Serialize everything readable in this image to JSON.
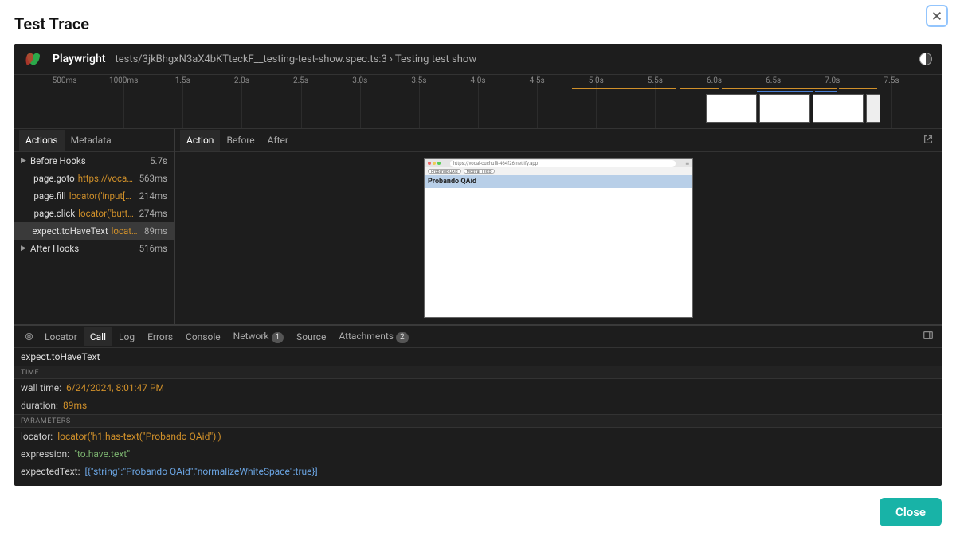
{
  "modal": {
    "title": "Test Trace",
    "close_btn": "Close"
  },
  "header": {
    "product": "Playwright",
    "spec": "tests/3jkBhgxN3aX4bKTteckF__testing-test-show.spec.ts:3 › Testing test show"
  },
  "timeline": {
    "ticks": [
      "500ms",
      "1000ms",
      "1.5s",
      "2.0s",
      "2.5s",
      "3.0s",
      "3.5s",
      "4.0s",
      "4.5s",
      "5.0s",
      "5.5s",
      "6.0s",
      "6.5s",
      "7.0s",
      "7.5s"
    ]
  },
  "left_tabs": {
    "actions": "Actions",
    "metadata": "Metadata"
  },
  "actions": {
    "before_hooks": {
      "label": "Before Hooks",
      "dur": "5.7s"
    },
    "after_hooks": {
      "label": "After Hooks",
      "dur": "516ms"
    },
    "steps": [
      {
        "name": "page.goto",
        "loc": "https://vocal-cu…",
        "dur": "563ms"
      },
      {
        "name": "page.fill",
        "loc": "locator('input[plac…",
        "dur": "214ms"
      },
      {
        "name": "page.click",
        "loc": "locator('button:…",
        "dur": "274ms"
      },
      {
        "name": "expect.toHaveText",
        "loc": "locator('…",
        "dur": "89ms"
      }
    ]
  },
  "right_tabs": {
    "action": "Action",
    "before": "Before",
    "after": "After"
  },
  "browser": {
    "url": "https://vocal-cuchufli-464f26.netlify.app",
    "btn1": "Probando QAid",
    "btn2": "Mostrar Texto",
    "h1": "Probando QAid"
  },
  "bottom_tabs": {
    "locator": "Locator",
    "call": "Call",
    "log": "Log",
    "errors": "Errors",
    "console": "Console",
    "network": "Network",
    "network_n": "1",
    "source": "Source",
    "attachments": "Attachments",
    "attachments_n": "2"
  },
  "call": {
    "title": "expect.toHaveText",
    "sec_time": "TIME",
    "wall_k": "wall time:",
    "wall_v": "6/24/2024, 8:01:47 PM",
    "dur_k": "duration:",
    "dur_v": "89ms",
    "sec_params": "PARAMETERS",
    "loc_k": "locator:",
    "loc_v": "locator('h1:has-text(\"Probando QAid\")')",
    "expr_k": "expression:",
    "expr_v": "\"to.have.text\"",
    "exp_k": "expectedText:",
    "exp_v": "[{\"string\":\"Probando QAid\",\"normalizeWhiteSpace\":true}]"
  }
}
